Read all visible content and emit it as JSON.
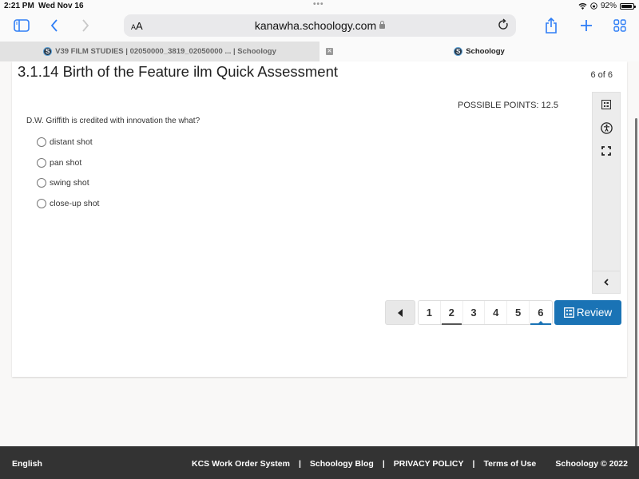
{
  "status_bar": {
    "time": "2:21 PM",
    "date": "Wed Nov 16",
    "battery_percent": "92%",
    "battery_level": 0.92
  },
  "browser": {
    "text_size_label": "AA",
    "url": "kanawha.schoology.com",
    "tabs": [
      {
        "label": "V39 FILM STUDIES | 02050000_3819_02050000 ... | Schoology",
        "active": false
      },
      {
        "label": "Schoology",
        "active": true
      }
    ],
    "favicon_letter": "S"
  },
  "assessment": {
    "title": "3.1.14 Birth of the Feature ilm Quick Assessment",
    "page_count": "6 of 6",
    "possible_points": "POSSIBLE POINTS: 12.5",
    "question": "D.W. Griffith is credited with innovation the what?",
    "options": [
      {
        "label": "distant shot",
        "selected": false
      },
      {
        "label": "pan shot",
        "selected": false
      },
      {
        "label": "swing shot",
        "selected": false
      },
      {
        "label": "close-up shot",
        "selected": false
      }
    ]
  },
  "tools": [
    "question-list-icon",
    "accessibility-icon",
    "fullscreen-icon"
  ],
  "pagination": {
    "pages": [
      "1",
      "2",
      "3",
      "4",
      "5",
      "6"
    ],
    "visited_page": "2",
    "current_page": "6",
    "review_label": "Review"
  },
  "footer": {
    "language": "English",
    "links": [
      "KCS Work Order System",
      "Schoology Blog",
      "PRIVACY POLICY",
      "Terms of Use"
    ],
    "separator": "|",
    "copyright": "Schoology © 2022"
  },
  "colors": {
    "accent": "#1a73b5",
    "ios_blue": "#2f7ef6",
    "footer_bg": "#333333"
  }
}
